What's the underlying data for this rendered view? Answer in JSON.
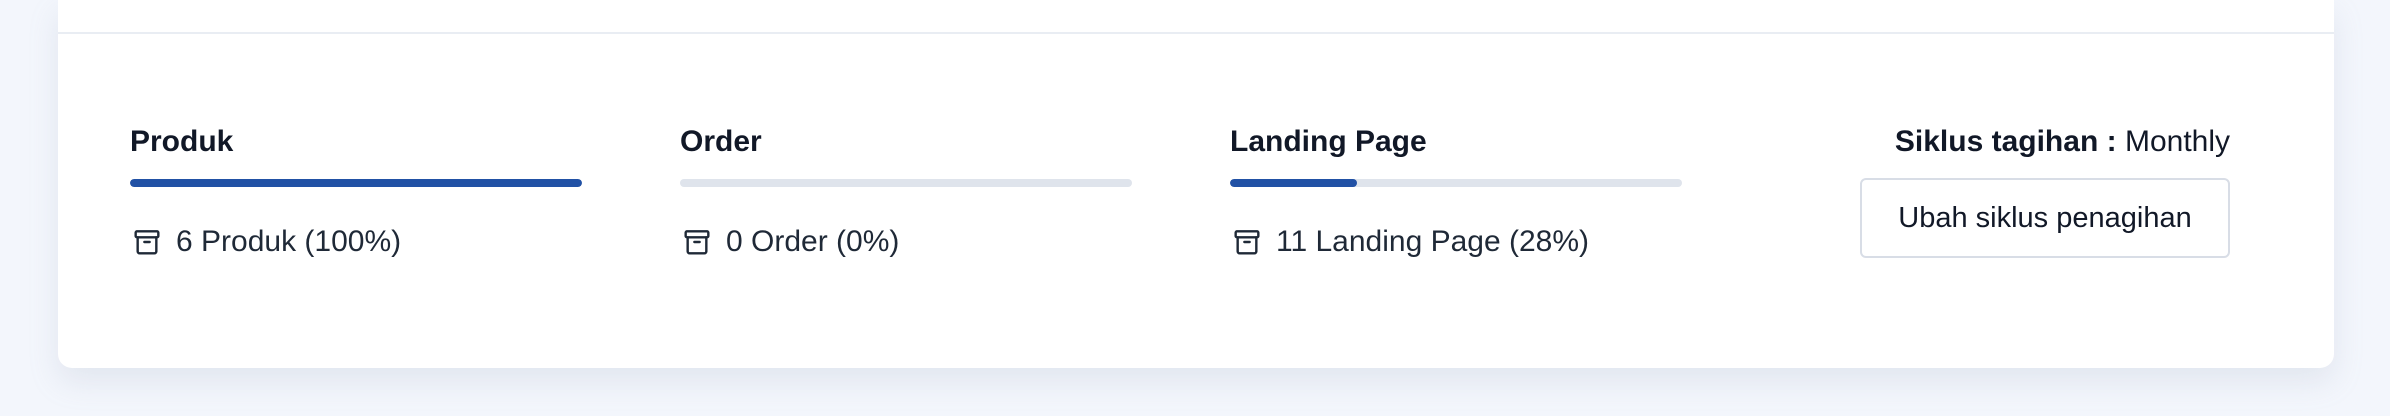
{
  "stats": [
    {
      "title": "Produk",
      "usage_text": "6 Produk (100%)",
      "progress_percent": 100
    },
    {
      "title": "Order",
      "usage_text": "0 Order (0%)",
      "progress_percent": 0
    },
    {
      "title": "Landing Page",
      "usage_text": "11 Landing Page (28%)",
      "progress_percent": 28
    }
  ],
  "billing": {
    "label": "Siklus tagihan :",
    "value": "Monthly",
    "button_label": "Ubah siklus penagihan"
  },
  "colors": {
    "progress_fill": "#2151a5",
    "progress_track": "#dfe4ec"
  },
  "icons": {
    "usage_icon": "archive-box-icon"
  }
}
